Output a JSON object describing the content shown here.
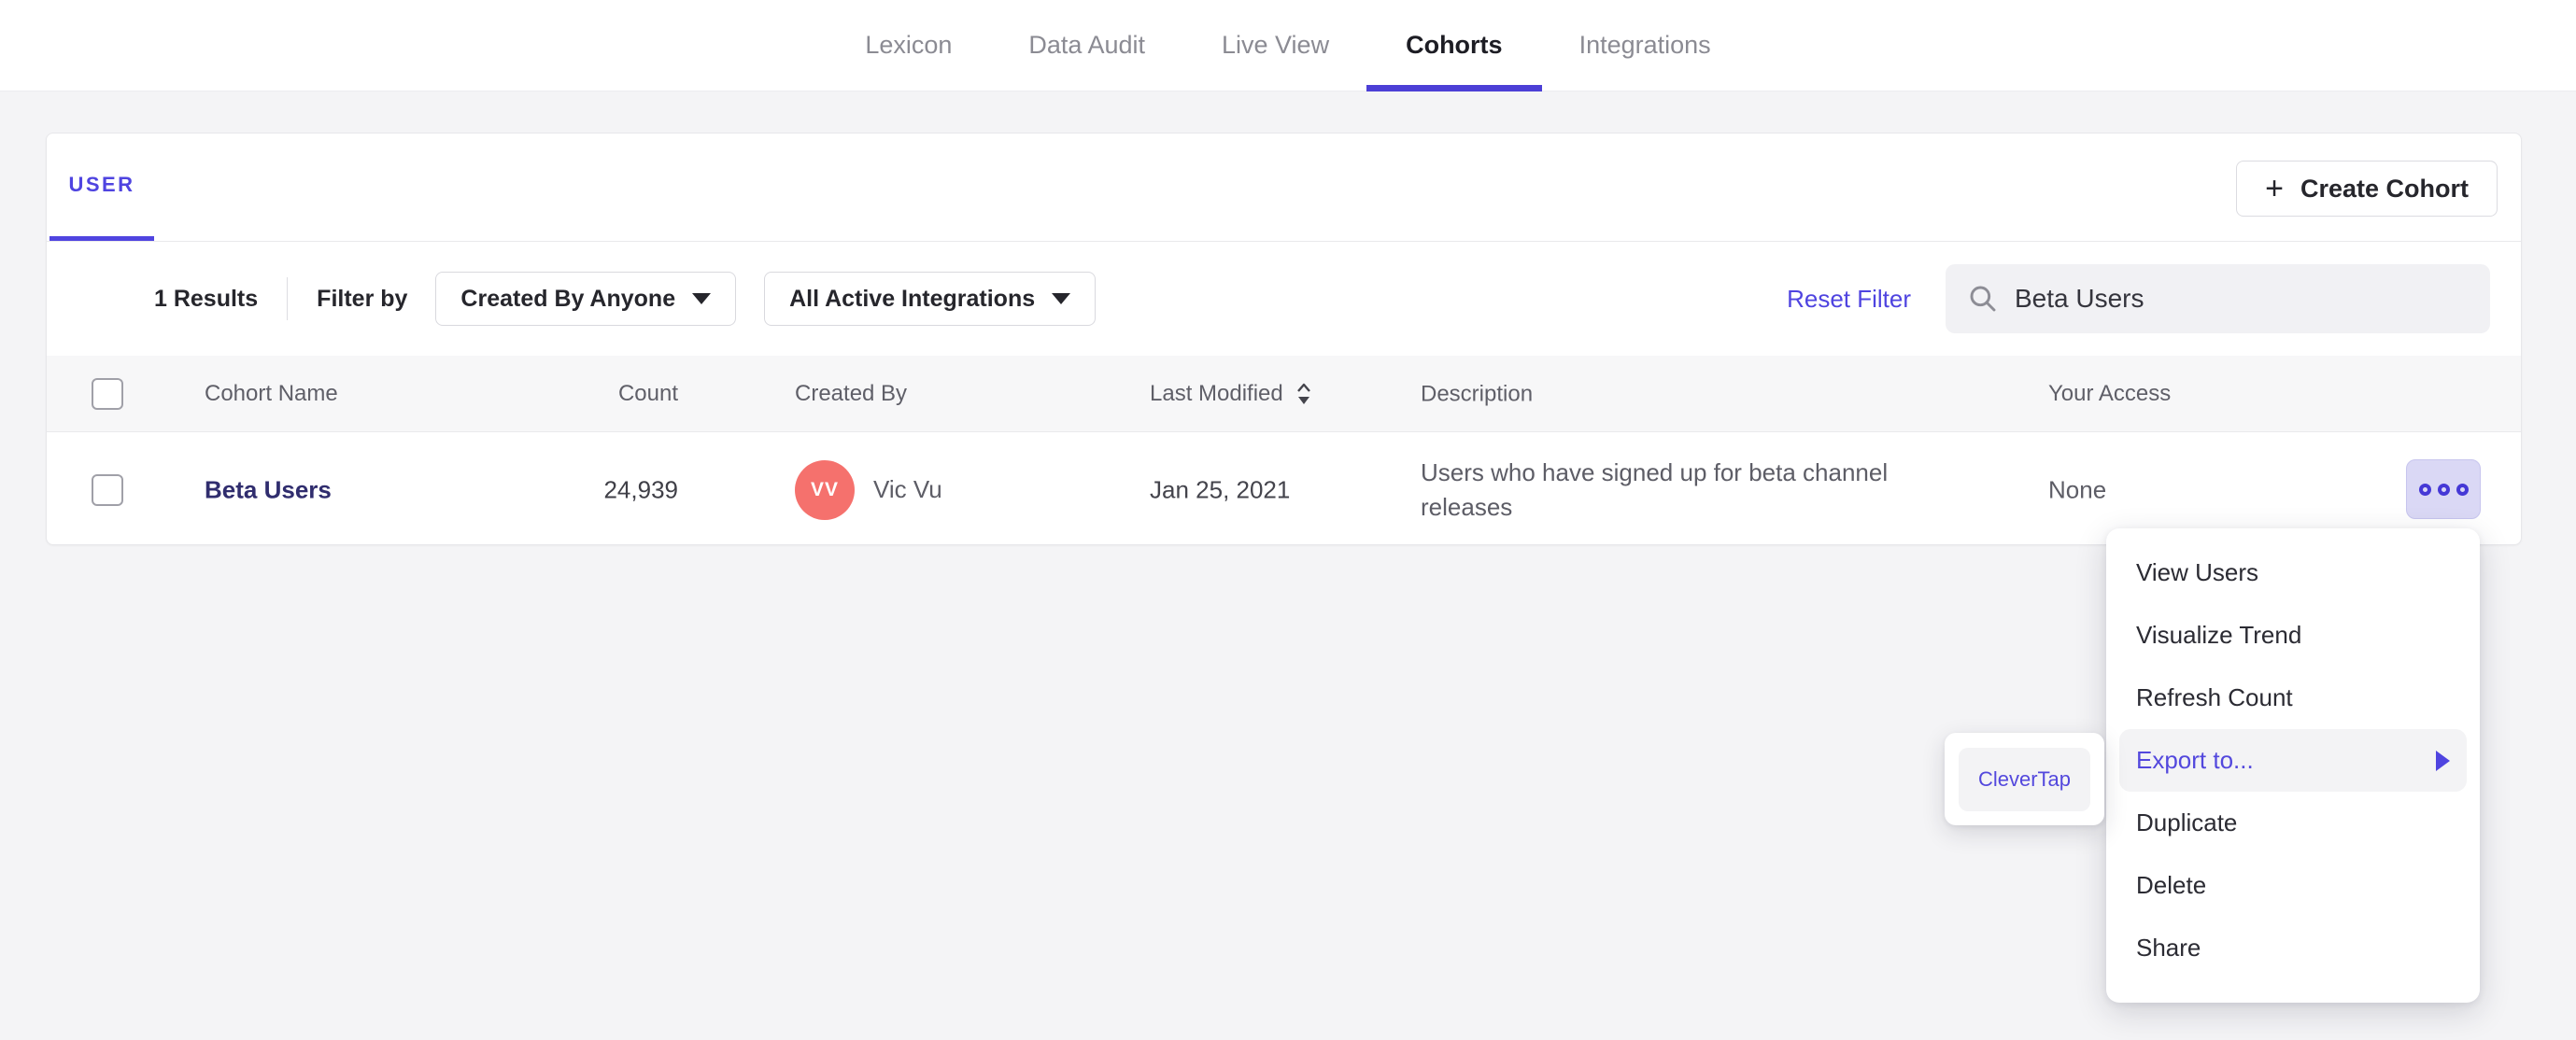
{
  "nav": {
    "items": [
      {
        "label": "Lexicon",
        "active": false
      },
      {
        "label": "Data Audit",
        "active": false
      },
      {
        "label": "Live View",
        "active": false
      },
      {
        "label": "Cohorts",
        "active": true
      },
      {
        "label": "Integrations",
        "active": false
      }
    ]
  },
  "cohorts_panel": {
    "tab_label": "USER",
    "create_button_label": "Create Cohort",
    "create_button_plus": "+",
    "results_count": "1 Results",
    "filter_by_label": "Filter by",
    "created_by_filter": "Created By Anyone",
    "integrations_filter": "All Active Integrations",
    "reset_filter_label": "Reset Filter",
    "search_value": "Beta Users"
  },
  "table": {
    "columns": {
      "name": "Cohort Name",
      "count": "Count",
      "created_by": "Created By",
      "last_modified": "Last Modified",
      "description": "Description",
      "your_access": "Your Access"
    },
    "rows": [
      {
        "name": "Beta Users",
        "count": "24,939",
        "avatar_initials": "VV",
        "created_by": "Vic Vu",
        "last_modified": "Jan 25, 2021",
        "description": "Users who have signed up for beta channel releases",
        "your_access": "None"
      }
    ]
  },
  "context_menu": {
    "items": [
      "View Users",
      "Visualize Trend",
      "Refresh Count",
      "Export to...",
      "Duplicate",
      "Delete",
      "Share"
    ],
    "highlighted_item": "Export to...",
    "submenu_items": [
      "CleverTap"
    ]
  },
  "colors": {
    "accent_purple": "#4f44e0",
    "nav_underline": "#4c3fd6",
    "cohort_link": "#302d6e",
    "avatar_coral": "#f5716d",
    "actions_button_bg": "#dad8f5",
    "menu_highlight_bg": "#f3f3f5",
    "header_bg": "#f7f7f8",
    "page_bg": "#f4f4f6"
  }
}
